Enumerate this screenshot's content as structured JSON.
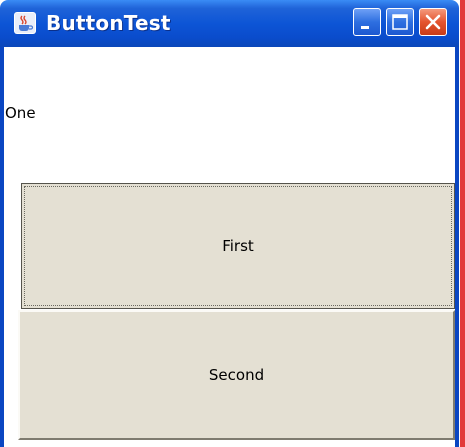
{
  "window": {
    "title": "ButtonTest",
    "app_icon": "java-cup-icon",
    "controls": {
      "minimize": "minimize-icon",
      "maximize": "maximize-icon",
      "close": "close-icon"
    }
  },
  "content": {
    "label": "One",
    "buttons": [
      {
        "label": "First",
        "focused": true
      },
      {
        "label": "Second",
        "focused": false
      }
    ]
  },
  "colors": {
    "titlebar": "#0d55d6",
    "frame": "#0a46c2",
    "button_face": "#e4e0d3",
    "close_button": "#e4542f"
  }
}
